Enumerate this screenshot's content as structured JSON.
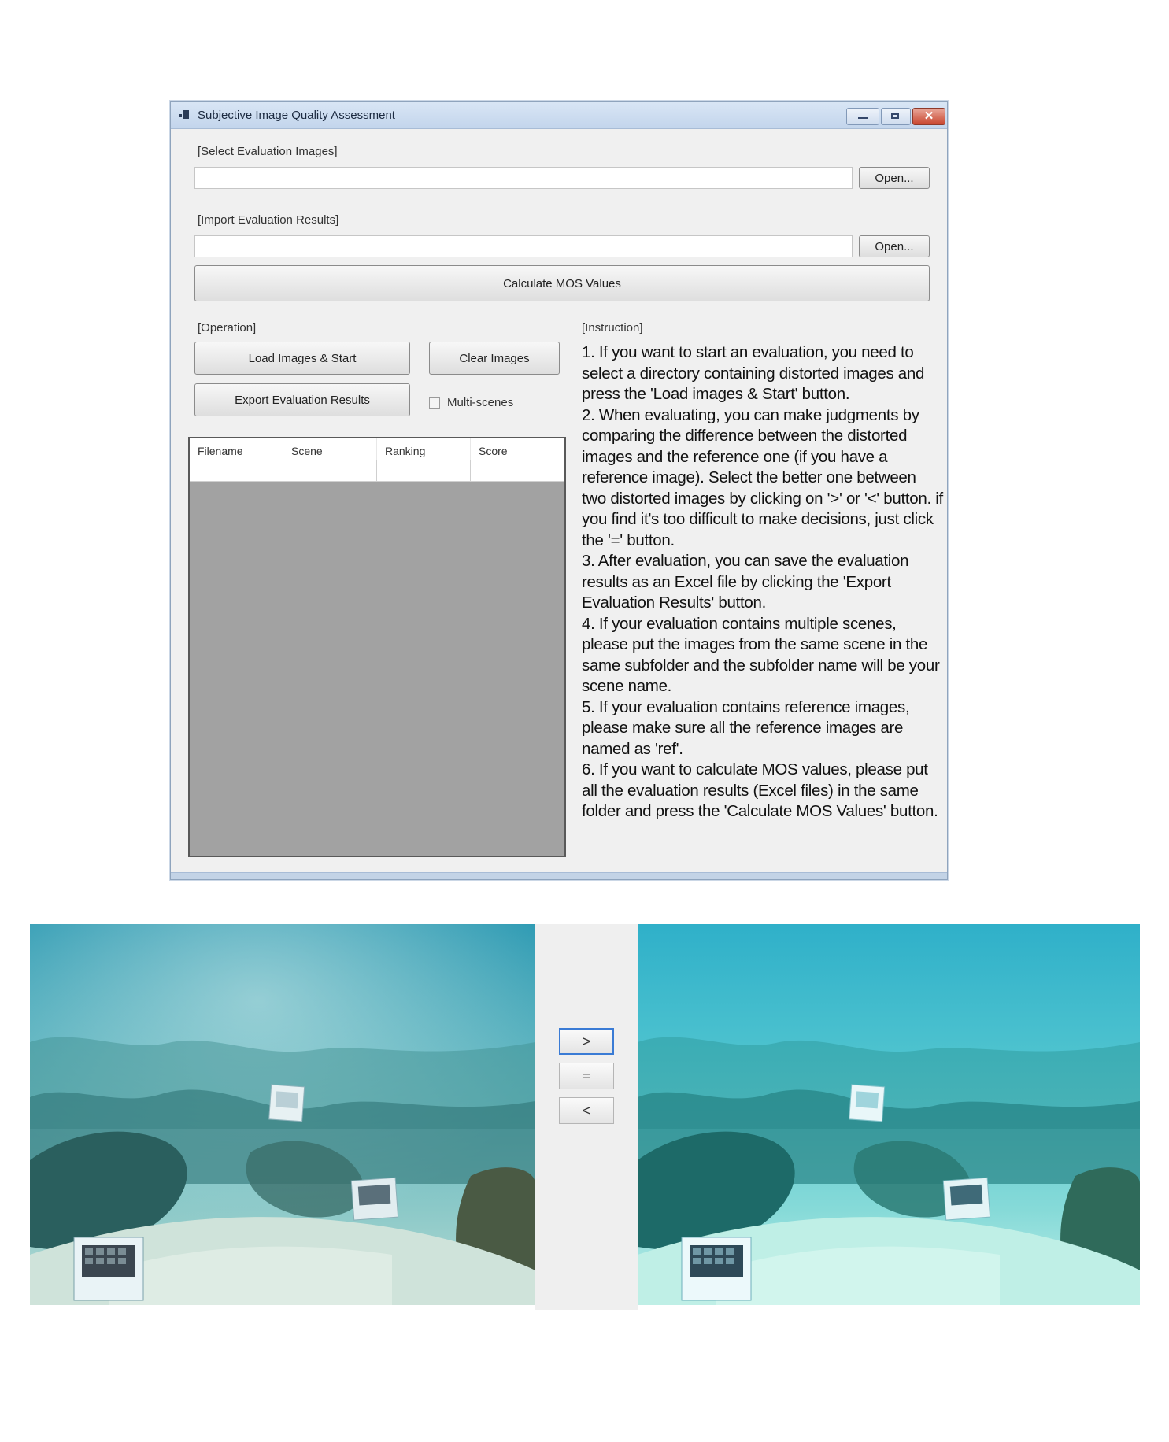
{
  "window": {
    "title": "Subjective Image Quality Assessment",
    "close_glyph": "✕"
  },
  "select_images": {
    "label": "[Select Evaluation Images]",
    "value": "",
    "open_label": "Open..."
  },
  "import_results": {
    "label": "[Import Evaluation Results]",
    "value": "",
    "open_label": "Open..."
  },
  "calculate_label": "Calculate MOS Values",
  "operation": {
    "label": "[Operation]",
    "load_label": "Load Images & Start",
    "clear_label": "Clear Images",
    "export_label": "Export Evaluation Results",
    "multi_scenes_label": "Multi-scenes",
    "multi_scenes_checked": false
  },
  "table": {
    "columns": [
      "Filename",
      "Scene",
      "Ranking",
      "Score"
    ],
    "rows": []
  },
  "instruction": {
    "label": "[Instruction]",
    "items": [
      "1. If you want to start an evaluation, you need to select a directory containing distorted images and press the 'Load images & Start' button.",
      "2. When evaluating, you can make judgments by comparing the difference between the distorted images and the reference one (if you have a reference image). Select the better one between two distorted images by clicking on '>' or '<' button. if you find it's too difficult to make decisions, just click the '=' button.",
      "3. After evaluation, you can save the evaluation results as an Excel file by clicking the 'Export Evaluation Results' button.",
      "4. If your evaluation contains multiple scenes, please put the images from the same scene in the same subfolder and the subfolder name will be your scene name.",
      "5. If your evaluation contains reference images, please make sure all the reference images are named as 'ref'.",
      "6. If you want to calculate MOS values, please put all the evaluation results (Excel files) in the same folder and press the 'Calculate MOS Values' button."
    ]
  },
  "comparison": {
    "greater": ">",
    "equal": "=",
    "less": "<"
  }
}
